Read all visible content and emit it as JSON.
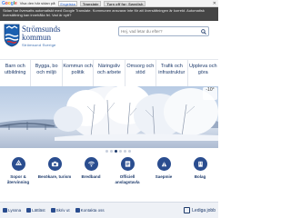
{
  "google_bar": {
    "logo": "Google",
    "view_label": "Visa den här sidan på:",
    "language": "Engelska",
    "translate_label": "Translate",
    "turn_off_label": "Turn off for: Swedish"
  },
  "notice": {
    "text": "Sidan har översatts automatiskt med Google Translate. Kommunen ansvarar inte för att översättningen är korrekt. Automatisk översättning kan innehålla fel. Vad är nytt?"
  },
  "header": {
    "brand_line1": "Strömsunds",
    "brand_line2": "kommun",
    "tagline": "Strömsund Sverige",
    "search_placeholder": "Hej, vad letar du efter?"
  },
  "nav": {
    "items": [
      "Barn och utbildning",
      "Bygga, bo och miljö",
      "Kommun och politik",
      "Näringsliv och arbete",
      "Omsorg och stöd",
      "Trafik och infrastruktur",
      "Uppleva och göra"
    ]
  },
  "hero": {
    "temperature": "-10°"
  },
  "quick_links": {
    "items": [
      {
        "label": "Sopor & återvinning",
        "icon": "recycle-icon"
      },
      {
        "label": "Besökare, turism",
        "icon": "camera-icon"
      },
      {
        "label": "Bredband",
        "icon": "wifi-icon"
      },
      {
        "label": "Officiell anslagstavla",
        "icon": "board-icon"
      },
      {
        "label": "Saepmie",
        "icon": "saepmie-icon"
      },
      {
        "label": "Bolag",
        "icon": "building-icon"
      }
    ]
  },
  "footer": {
    "listen": "Lyssna",
    "easy_read": "Lättläst",
    "write": "Skriv ut",
    "contact": "Kontakta oss",
    "jobs": "Lediga jobb"
  },
  "colors": {
    "brand": "#1b3e80",
    "accent_icon": "#2a4d8f"
  }
}
